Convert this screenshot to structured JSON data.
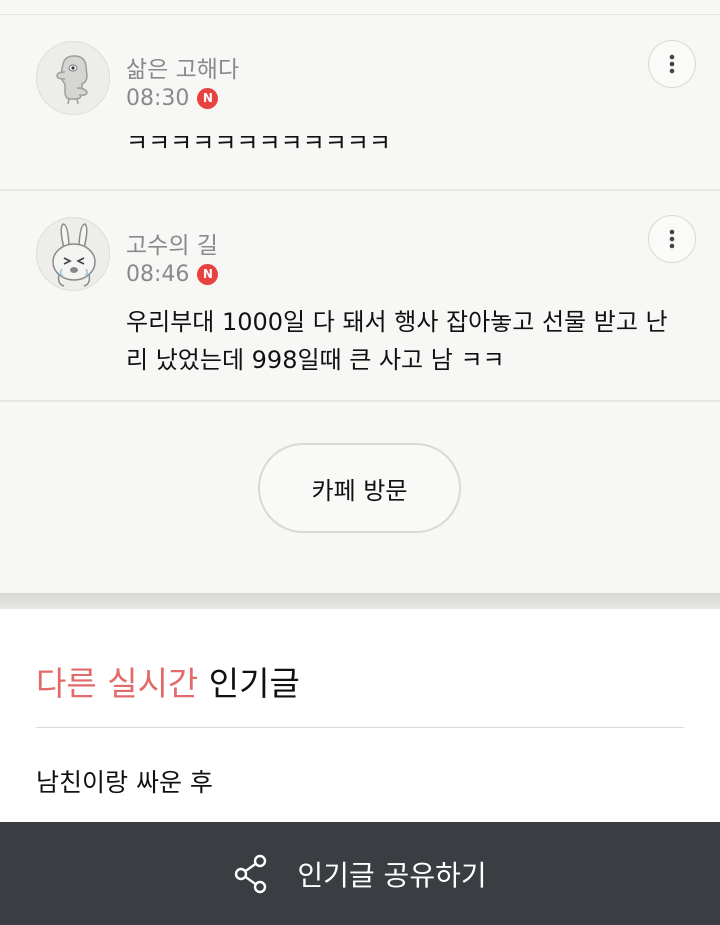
{
  "comments": [
    {
      "author": "삶은 고해다",
      "time": "08:30",
      "badge": "N",
      "text": "ㅋㅋㅋㅋㅋㅋㅋㅋㅋㅋㅋㅋ"
    },
    {
      "author": "고수의 길",
      "time": "08:46",
      "badge": "N",
      "text": "우리부대 1000일 다 돼서 행사 잡아놓고 선물 받고 난리 났었는데 998일때 큰 사고 남 ㅋㅋ"
    }
  ],
  "cafe_button": {
    "label": "카페 방문"
  },
  "popular": {
    "title_accent": "다른 실시간",
    "title_plain": "인기글",
    "items": [
      "남친이랑 싸운 후"
    ]
  },
  "share_bar": {
    "label": "인기글 공유하기"
  },
  "colors": {
    "accent": "#e26a6a",
    "badge": "#e8423f",
    "share_bar_bg": "#3a3d41"
  },
  "icons": [
    "avatar-character-icon",
    "avatar-rabbit-icon",
    "more-vertical-icon",
    "share-icon"
  ]
}
